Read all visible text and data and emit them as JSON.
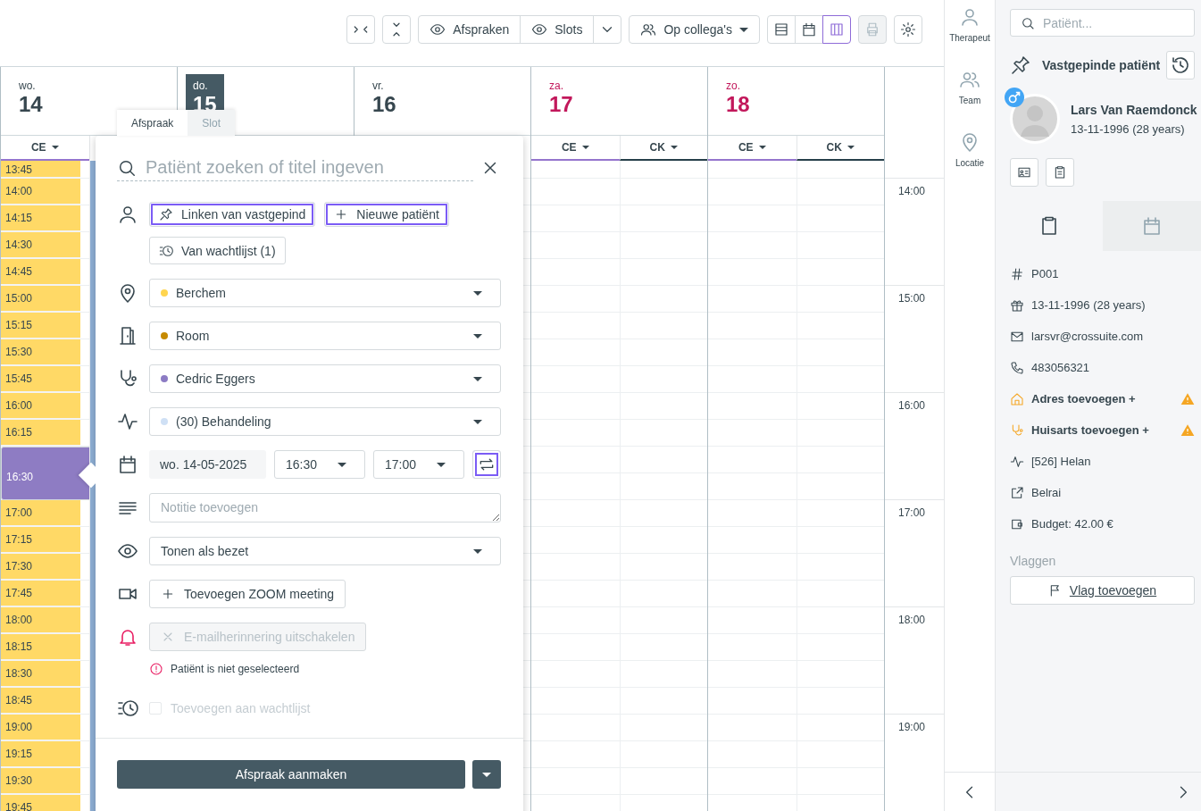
{
  "toolbar": {
    "filters": [
      {
        "label": "Afspraken"
      },
      {
        "label": "Slots"
      }
    ],
    "colleagues": "Op collega's",
    "views": [
      {
        "kind": "list",
        "selected": false
      },
      {
        "kind": "calendar",
        "selected": false
      },
      {
        "kind": "columns",
        "selected": true
      }
    ],
    "print": {
      "disabled": true
    }
  },
  "days": [
    {
      "weekday": "wo.",
      "day": "14",
      "today": false,
      "weekend": false,
      "columns": [
        {
          "label": "CE",
          "color": "#9575cd"
        }
      ]
    },
    {
      "weekday": "do.",
      "day": "15",
      "today": true,
      "weekend": false
    },
    {
      "weekday": "vr.",
      "day": "16",
      "today": false,
      "weekend": false
    },
    {
      "weekday": "za.",
      "day": "17",
      "today": false,
      "weekend": true,
      "columns": [
        {
          "label": "CE",
          "color": "#9575cd"
        },
        {
          "label": "CK",
          "color": "#263f4a"
        }
      ]
    },
    {
      "weekday": "zo.",
      "day": "18",
      "today": false,
      "weekend": true,
      "columns": [
        {
          "label": "CE",
          "color": "#9575cd"
        },
        {
          "label": "CK",
          "color": "#263f4a"
        }
      ]
    }
  ],
  "slots": [
    {
      "time": "13:45",
      "selected": false
    },
    {
      "time": "14:00",
      "selected": false
    },
    {
      "time": "14:15",
      "selected": false
    },
    {
      "time": "14:30",
      "selected": false
    },
    {
      "time": "14:45",
      "selected": false
    },
    {
      "time": "15:00",
      "selected": false
    },
    {
      "time": "15:15",
      "selected": false
    },
    {
      "time": "15:30",
      "selected": false
    },
    {
      "time": "15:45",
      "selected": false
    },
    {
      "time": "16:00",
      "selected": false
    },
    {
      "time": "16:15",
      "selected": false
    },
    {
      "time": "16:30",
      "selected": true
    },
    {
      "time": "17:00",
      "selected": false
    },
    {
      "time": "17:15",
      "selected": false
    },
    {
      "time": "17:30",
      "selected": false
    },
    {
      "time": "17:45",
      "selected": false
    },
    {
      "time": "18:00",
      "selected": false
    },
    {
      "time": "18:15",
      "selected": false
    },
    {
      "time": "18:30",
      "selected": false
    },
    {
      "time": "18:45",
      "selected": false
    },
    {
      "time": "19:00",
      "selected": false
    },
    {
      "time": "19:15",
      "selected": false
    },
    {
      "time": "19:30",
      "selected": false
    },
    {
      "time": "19:45",
      "selected": false
    }
  ],
  "time_axis": [
    "14:00",
    "15:00",
    "16:00",
    "17:00",
    "18:00",
    "19:00"
  ],
  "appointment": {
    "tabs": [
      {
        "label": "Afspraak",
        "selected": true
      },
      {
        "label": "Slot",
        "selected": false
      }
    ],
    "search": {
      "placeholder": "Patiënt zoeken of titel ingeven"
    },
    "patient_buttons": [
      {
        "kind": "pin",
        "label": "Linken van vastgepind",
        "highlighted": true
      },
      {
        "kind": "plus",
        "label": "Nieuwe patiënt",
        "highlighted": true
      },
      {
        "kind": "waitlist",
        "label": "Van wachtlijst (1)",
        "highlighted": false
      }
    ],
    "selects": [
      {
        "kind": "location",
        "value": "Berchem",
        "color": "#ffd54f"
      },
      {
        "kind": "room",
        "value": "Room",
        "color": "#c68a00"
      },
      {
        "kind": "therapist",
        "value": "Cedric Eggers",
        "color": "#8c7bc4"
      },
      {
        "kind": "activity",
        "value": "(30) Behandeling",
        "color": "#cfe0f5"
      }
    ],
    "date": "wo. 14-05-2025",
    "start": "16:30",
    "end": "17:00",
    "repeat": {
      "highlighted": true
    },
    "note": {
      "placeholder": "Notitie toevoegen"
    },
    "visibility": "Tonen als bezet",
    "zoom": {
      "label": "Toevoegen ZOOM meeting",
      "disabled": false
    },
    "reminder": {
      "label": "E-mailherinnering uitschakelen",
      "disabled": true
    },
    "error": "Patiënt is niet geselecteerd",
    "waitlist": {
      "label": "Toevoegen aan wachtlijst",
      "checked": false,
      "disabled": true
    },
    "submit": "Afspraak aanmaken"
  },
  "nav": [
    {
      "kind": "person",
      "label": "Therapeut"
    },
    {
      "kind": "people",
      "label": "Team"
    },
    {
      "kind": "location",
      "label": "Locatie"
    }
  ],
  "patient_panel": {
    "search": {
      "placeholder": "Patiënt..."
    },
    "title": "Vastgepinde patiënt",
    "name": "Lars Van Raemdonck",
    "birth": "13-11-1996 (28 years)",
    "tabs": [
      {
        "kind": "clipboard",
        "selected": true
      },
      {
        "kind": "calendar",
        "selected": false
      }
    ],
    "info": [
      {
        "kind": "id",
        "text": "P001",
        "warning": false
      },
      {
        "kind": "birthday",
        "text": "13-11-1996 (28 years)",
        "warning": false
      },
      {
        "kind": "email",
        "text": "larsvr@crossuite.com",
        "warning": false
      },
      {
        "kind": "phone",
        "text": "483056321",
        "warning": false
      },
      {
        "kind": "address",
        "text": "Adres toevoegen +",
        "warning": true
      },
      {
        "kind": "doctor",
        "text": "Huisarts toevoegen +",
        "warning": true
      },
      {
        "kind": "insurance",
        "text": "[526] Helan",
        "warning": false
      },
      {
        "kind": "external",
        "text": "Belrai",
        "warning": false
      },
      {
        "kind": "budget",
        "text": "Budget: 42.00 €",
        "warning": false
      }
    ],
    "flags_label": "Vlaggen",
    "flag_button": "Vlag toevoegen"
  }
}
